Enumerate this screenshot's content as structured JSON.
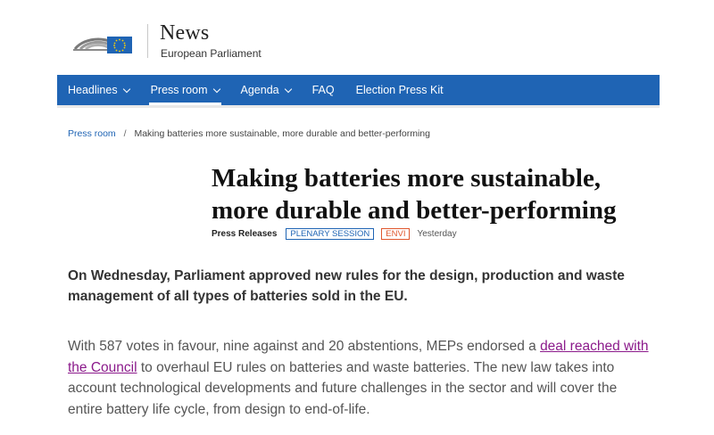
{
  "header": {
    "title": "News",
    "subtitle": "European Parliament"
  },
  "nav": {
    "items": [
      {
        "label": "Headlines",
        "has_dropdown": true,
        "active": false
      },
      {
        "label": "Press room",
        "has_dropdown": true,
        "active": true
      },
      {
        "label": "Agenda",
        "has_dropdown": true,
        "active": false
      },
      {
        "label": "FAQ",
        "has_dropdown": false,
        "active": false
      },
      {
        "label": "Election Press Kit",
        "has_dropdown": false,
        "active": false
      }
    ]
  },
  "breadcrumb": {
    "link": "Press room",
    "separator": "/",
    "current": "Making batteries more sustainable, more durable and better-performing"
  },
  "article": {
    "title_line1": "Making batteries more sustainable,",
    "title_line2": "more durable and better-performing",
    "type": "Press Releases",
    "tags": [
      "PLENARY SESSION",
      "ENVI"
    ],
    "date": "Yesterday",
    "lead": "On Wednesday, Parliament approved new rules for the design, production and waste management of all types of batteries sold in the EU.",
    "para_before_link": "With 587 votes in favour, nine against and 20 abstentions, MEPs endorsed a ",
    "para_link": "deal reached with the Council",
    "para_after_link": " to overhaul EU rules on batteries and waste batteries. The new law takes into account technological developments and future challenges in the sector and will cover the entire battery life cycle, from design to end-of-life."
  },
  "colors": {
    "nav_bg": "#1f64b4",
    "eu_flag": "#1f64b4",
    "link_visited": "#8b1a8b",
    "tag_envi": "#e0572d"
  }
}
